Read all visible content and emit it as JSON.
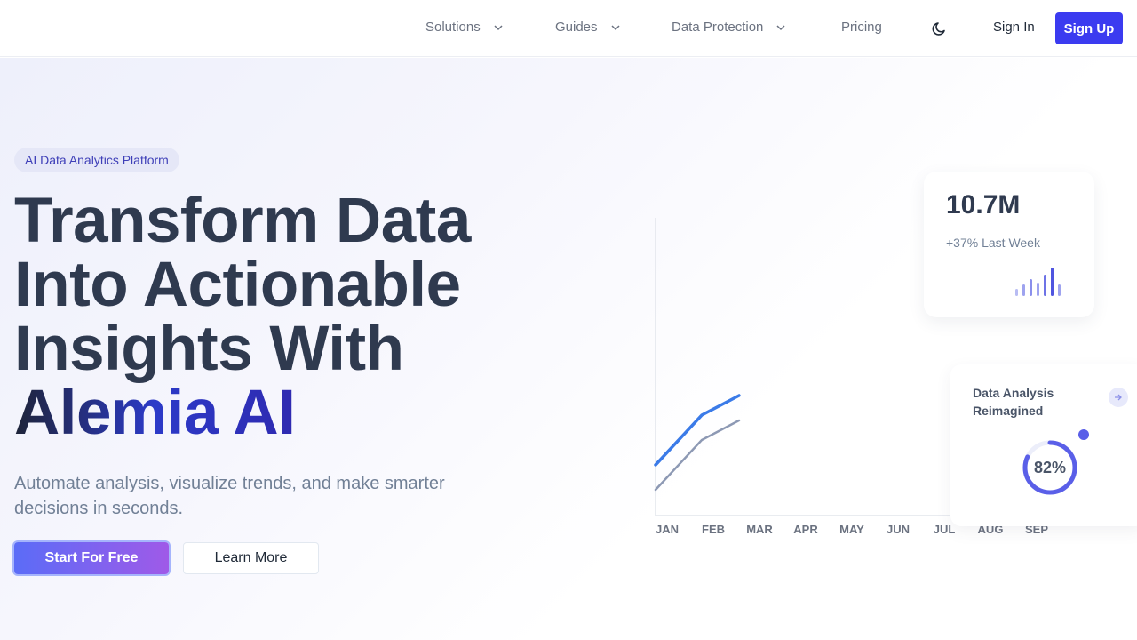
{
  "nav": {
    "items": [
      {
        "label": "Solutions",
        "has_dropdown": true
      },
      {
        "label": "Guides",
        "has_dropdown": true
      },
      {
        "label": "Data Protection",
        "has_dropdown": true
      },
      {
        "label": "Pricing",
        "has_dropdown": false
      }
    ],
    "theme_icon": "moon-icon",
    "sign_in": "Sign In",
    "sign_up": "Sign Up",
    "accent": "#3b3bf0"
  },
  "hero": {
    "badge": "AI Data Analytics Platform",
    "headline_lines": [
      "Transform Data",
      "Into Actionable",
      "Insights With"
    ],
    "headline_brand": "Alemia AI",
    "subtitle": "Automate analysis, visualize trends, and make smarter decisions in seconds.",
    "cta_primary": "Start For Free",
    "cta_secondary": "Learn More"
  },
  "chart": {
    "months": [
      "JAN",
      "FEB",
      "MAR",
      "APR",
      "MAY",
      "JUN",
      "JUL",
      "AUG",
      "SEP"
    ]
  },
  "stat_card": {
    "value": "10.7M",
    "delta": "+37% Last Week"
  },
  "analysis_card": {
    "title_line1": "Data Analysis",
    "title_line2": "Reimagined",
    "percent_label": "82%",
    "percent": 0.82,
    "arrow_icon": "arrow-right-icon"
  }
}
